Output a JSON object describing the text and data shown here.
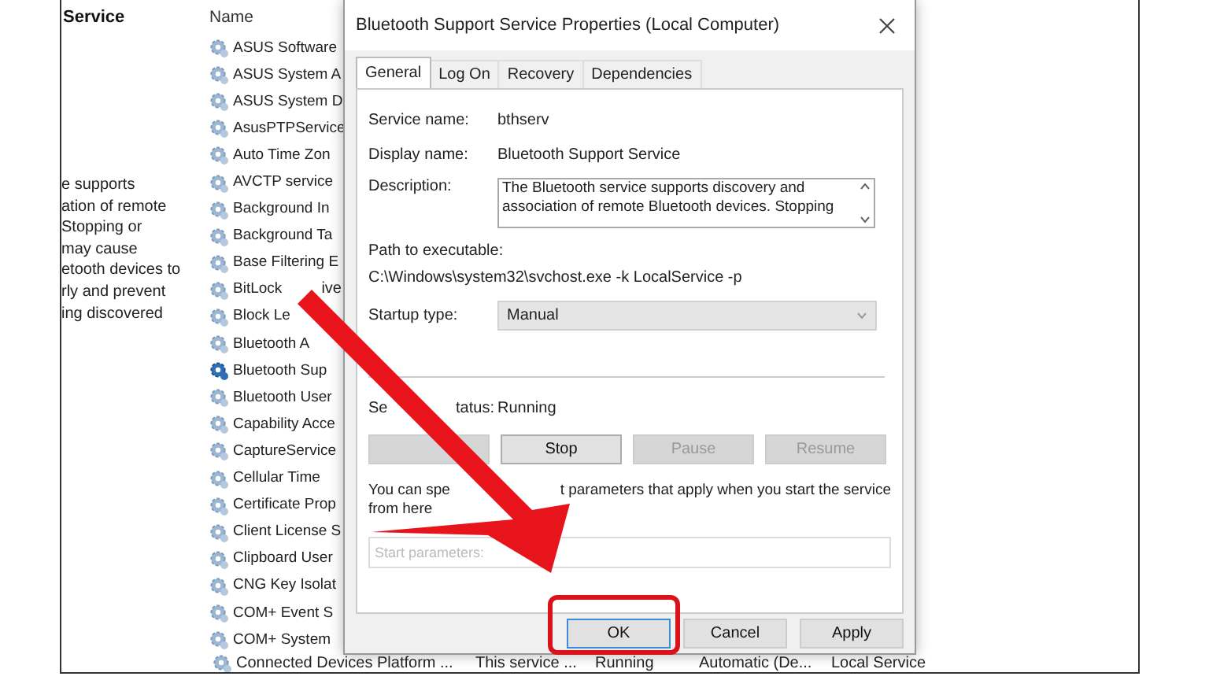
{
  "left_pane": {
    "heading": "Service",
    "description_lines": [
      "e supports",
      "ation of remote",
      "Stopping or",
      "may cause",
      "etooth devices to",
      "rly and prevent",
      "ing discovered"
    ]
  },
  "services": {
    "column": "Name",
    "items": [
      {
        "name": "ASUS Software",
        "selected": false
      },
      {
        "name": "ASUS System A",
        "selected": false
      },
      {
        "name": "ASUS System D",
        "selected": false
      },
      {
        "name": "AsusPTPService",
        "selected": false
      },
      {
        "name": "Auto Time Zon",
        "selected": false
      },
      {
        "name": "AVCTP service",
        "selected": false
      },
      {
        "name": "Background In",
        "selected": false
      },
      {
        "name": "Background Ta",
        "selected": false
      },
      {
        "name": "Base Filtering E",
        "selected": false
      },
      {
        "name": "BitLock",
        "tail": "ive",
        "selected": false
      },
      {
        "name": "Block Le",
        "selected": false
      },
      {
        "name": "Bluetooth A",
        "selected": false
      },
      {
        "name": "Bluetooth Sup",
        "selected": true
      },
      {
        "name": "Bluetooth User",
        "selected": false
      },
      {
        "name": "Capability Acce",
        "selected": false
      },
      {
        "name": "CaptureService",
        "selected": false
      },
      {
        "name": "Cellular Time",
        "selected": false
      },
      {
        "name": "Certificate Prop",
        "selected": false
      },
      {
        "name": "Client License S",
        "selected": false
      },
      {
        "name": "Clipboard User",
        "selected": false
      },
      {
        "name": "CNG Key Isolat",
        "selected": false
      },
      {
        "name": "COM+ Event S",
        "selected": false
      },
      {
        "name": "COM+ System",
        "selected": false
      }
    ],
    "last_row": [
      "Connected Devices Platform ...",
      "This service ...",
      "Running",
      "Automatic (De...",
      "Local Service"
    ]
  },
  "dialog": {
    "title": "Bluetooth Support Service Properties (Local Computer)",
    "tabs": [
      {
        "label": "General",
        "selected": true
      },
      {
        "label": "Log On",
        "selected": false
      },
      {
        "label": "Recovery",
        "selected": false
      },
      {
        "label": "Dependencies",
        "selected": false
      }
    ],
    "service_name": {
      "label": "Service name:",
      "value": "bthserv"
    },
    "display_name": {
      "label": "Display name:",
      "value": "Bluetooth Support Service"
    },
    "description": {
      "label": "Description:",
      "value": "The Bluetooth service supports discovery and association of remote Bluetooth devices.  Stopping"
    },
    "path": {
      "label": "Path to executable:",
      "value": "C:\\Windows\\system32\\svchost.exe -k LocalService -p"
    },
    "startup_type": {
      "label": "Startup type:",
      "value": "Manual"
    },
    "service_status": {
      "label_parts": [
        "Se",
        "tatus:"
      ],
      "value": "Running"
    },
    "control_buttons": [
      {
        "disabled": true
      },
      {
        "label": "Stop",
        "disabled": false
      },
      {
        "label": "Pause",
        "disabled": true
      },
      {
        "label": "Resume",
        "disabled": true
      }
    ],
    "hint_parts": [
      "You can spe",
      "t parameters that apply when you start the service",
      "from here"
    ],
    "start_parameters": {
      "placeholder": "Start parameters:"
    },
    "buttons": [
      {
        "label": "OK",
        "highlighted": true
      },
      {
        "label": "Cancel",
        "highlighted": false
      },
      {
        "label": "Apply",
        "highlighted": false
      }
    ]
  }
}
